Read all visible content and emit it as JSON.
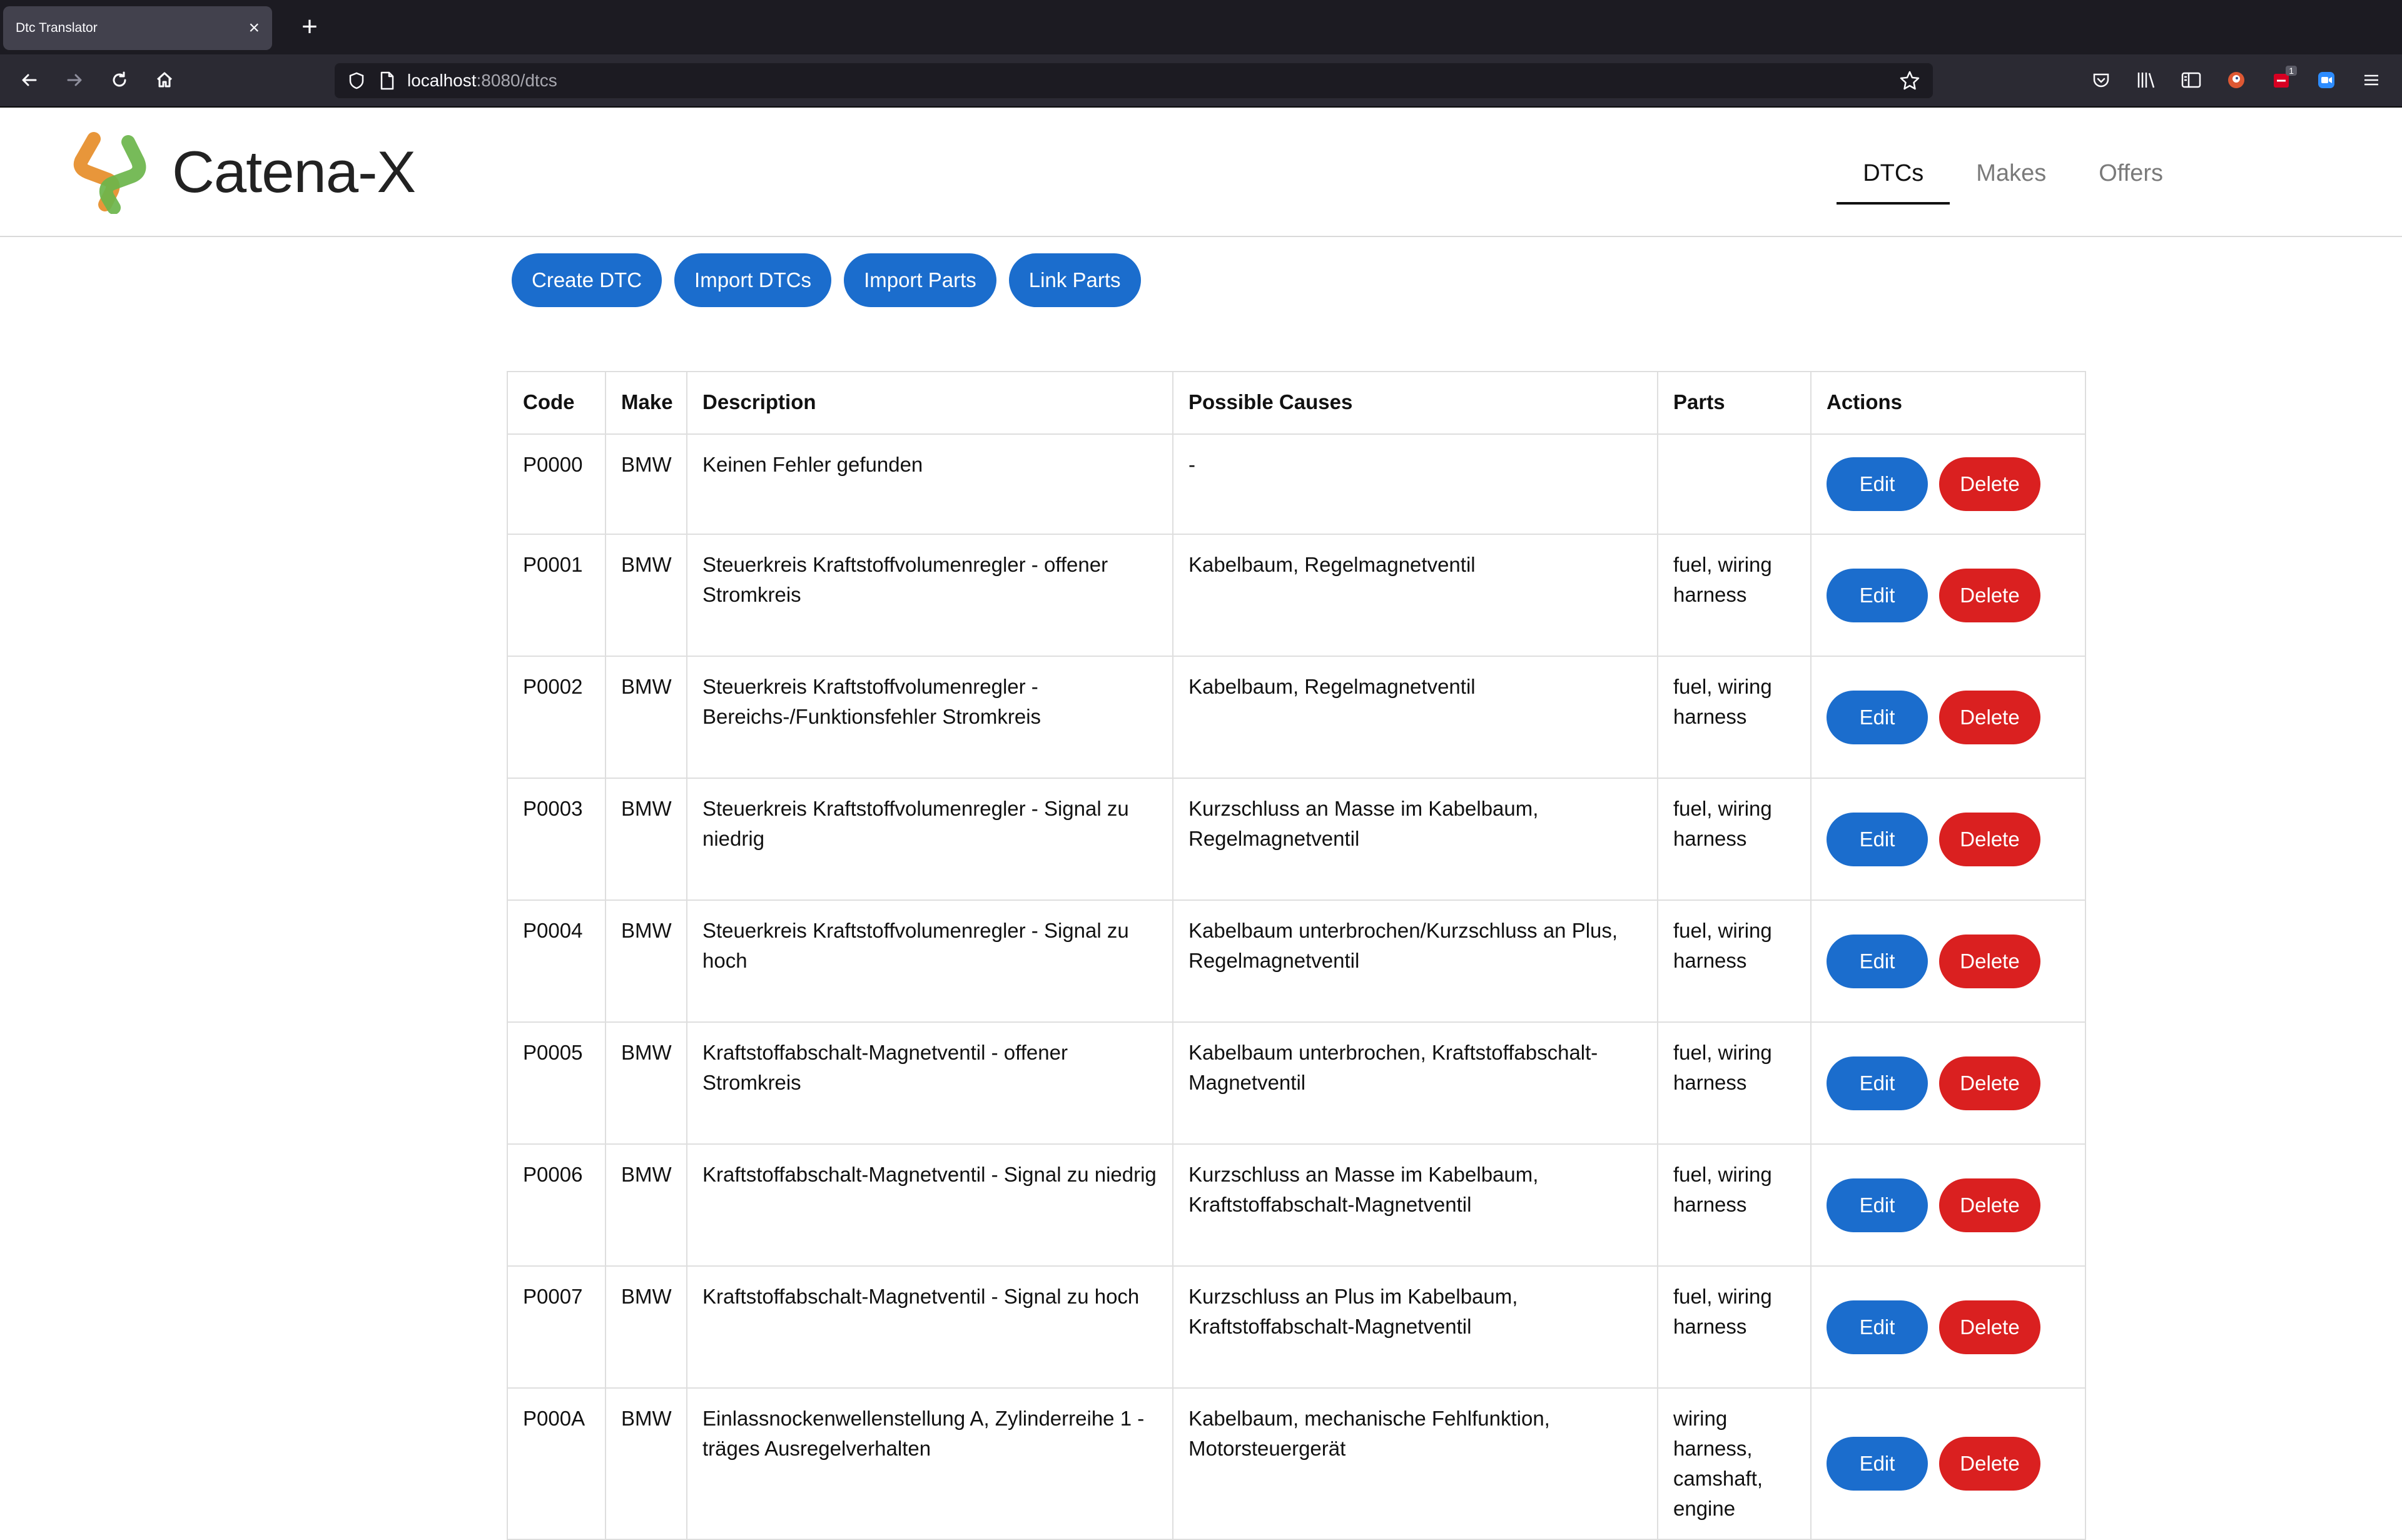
{
  "browser": {
    "tab_title": "Dtc Translator",
    "tab_close": "×",
    "new_tab": "+",
    "url_host": "localhost",
    "url_path": ":8080/dtcs",
    "ext_badge": "1"
  },
  "app": {
    "logo_text": "Catena-X",
    "nav": [
      "DTCs",
      "Makes",
      "Offers"
    ],
    "active_nav": "DTCs"
  },
  "toolbar": {
    "create_dtc": "Create DTC",
    "import_dtcs": "Import DTCs",
    "import_parts": "Import Parts",
    "link_parts": "Link Parts"
  },
  "table": {
    "headers": [
      "Code",
      "Make",
      "Description",
      "Possible Causes",
      "Parts",
      "Actions"
    ],
    "edit_label": "Edit",
    "delete_label": "Delete",
    "rows": [
      {
        "code": "P0000",
        "make": "BMW",
        "description": "Keinen Fehler gefunden",
        "causes": "-",
        "parts": ""
      },
      {
        "code": "P0001",
        "make": "BMW",
        "description": "Steuerkreis Kraftstoffvolumenregler - offener Stromkreis",
        "causes": "Kabelbaum, Regelmagnetventil",
        "parts": "fuel, wiring harness"
      },
      {
        "code": "P0002",
        "make": "BMW",
        "description": "Steuerkreis Kraftstoffvolumenregler - Bereichs-/Funktionsfehler Stromkreis",
        "causes": "Kabelbaum, Regelmagnetventil",
        "parts": "fuel, wiring harness"
      },
      {
        "code": "P0003",
        "make": "BMW",
        "description": "Steuerkreis Kraftstoffvolumenregler - Signal zu niedrig",
        "causes": "Kurzschluss an Masse im Kabelbaum, Regelmagnetventil",
        "parts": "fuel, wiring harness"
      },
      {
        "code": "P0004",
        "make": "BMW",
        "description": "Steuerkreis Kraftstoffvolumenregler - Signal zu hoch",
        "causes": "Kabelbaum unterbrochen/Kurzschluss an Plus, Regelmagnetventil",
        "parts": "fuel, wiring harness"
      },
      {
        "code": "P0005",
        "make": "BMW",
        "description": "Kraftstoffabschalt-Magnetventil - offener Stromkreis",
        "causes": "Kabelbaum unterbrochen, Kraftstoffabschalt-Magnetventil",
        "parts": "fuel, wiring harness"
      },
      {
        "code": "P0006",
        "make": "BMW",
        "description": "Kraftstoffabschalt-Magnetventil - Signal zu niedrig",
        "causes": "Kurzschluss an Masse im Kabelbaum, Kraftstoffabschalt-Magnetventil",
        "parts": "fuel, wiring harness"
      },
      {
        "code": "P0007",
        "make": "BMW",
        "description": "Kraftstoffabschalt-Magnetventil - Signal zu hoch",
        "causes": "Kurzschluss an Plus im Kabelbaum, Kraftstoffabschalt-Magnetventil",
        "parts": "fuel, wiring harness"
      },
      {
        "code": "P000A",
        "make": "BMW",
        "description": "Einlassnockenwellenstellung A, Zylinderreihe 1 - träges Ausregelverhalten",
        "causes": "Kabelbaum, mechanische Fehlfunktion, Motorsteuergerät",
        "parts": "wiring harness, camshaft, engine"
      }
    ]
  }
}
